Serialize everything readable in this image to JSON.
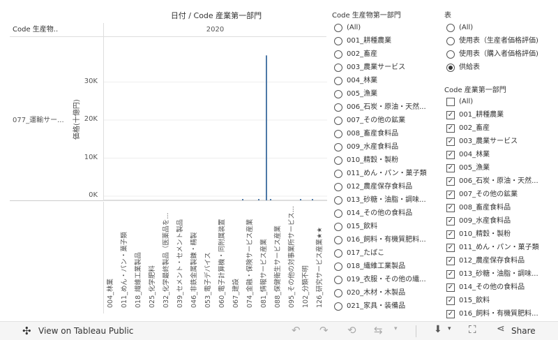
{
  "sheet": {
    "title": "日付 / Code 産業第一部門",
    "row_header": "Code 生産物..",
    "column_header": "2020",
    "row_label": "077_運輸サー...",
    "y_axis_title": "価格(十億円)"
  },
  "chart_data": {
    "type": "bar",
    "ylabel": "価格(十億円)",
    "ylim": [
      0,
      40000
    ],
    "y_ticks": [
      "0K",
      "10K",
      "20K",
      "30K"
    ],
    "categories": [
      "004_林業",
      "011_めん・パン・菓子類",
      "018_繊維工業製品",
      "025_化学肥料",
      "032_化学最終製品（医薬品を...",
      "039_セメント・セメント製品",
      "046_非鉄金属製錬・精製",
      "053_電子デバイス",
      "060_電子計算機・同附属装置",
      "067_建設",
      "074_金融・保険サービス産業",
      "081_情報サービス産業",
      "088_保健衛生サービス産業",
      "095_その他の対事業所サービス...",
      "102_分類不明",
      "126_研究サービス産業★★"
    ],
    "values": [
      0,
      0,
      0,
      0,
      0,
      0,
      0,
      0,
      0,
      0,
      0,
      37000,
      0,
      0,
      0,
      0
    ],
    "small_bars": [
      {
        "after_category": "067_建設",
        "value": 300
      },
      {
        "after_category": "074_金融・保険サービス産業",
        "value": 300
      },
      {
        "after_category": "081_情報サービス産業",
        "value": 200
      },
      {
        "after_category": "095_その他の対事業所サービス...",
        "value": 300
      },
      {
        "after_category": "102_分類不明",
        "value": 200
      }
    ],
    "bar_color": "#4e79a7"
  },
  "filter_product": {
    "title": "Code 生産物第一部門",
    "items": [
      "(All)",
      "001_耕種農業",
      "002_畜産",
      "003_農業サービス",
      "004_林業",
      "005_漁業",
      "006_石炭・原油・天然...",
      "007_その他の鉱業",
      "008_畜産食料品",
      "009_水産食料品",
      "010_精穀・製粉",
      "011_めん・パン・菓子類",
      "012_農産保存食料品",
      "013_砂糖・油脂・調味...",
      "014_その他の食料品",
      "015_飲料",
      "016_飼料・有機質肥料...",
      "017_たばこ",
      "018_繊維工業製品",
      "019_衣服・その他の繊...",
      "020_木材・木製品",
      "021_家具・装備品"
    ]
  },
  "filter_table": {
    "title": "表",
    "items": [
      "(All)",
      "使用表（生産者価格評価)",
      "使用表（購入者価格評価)",
      "供給表"
    ],
    "selected": "供給表"
  },
  "filter_industry": {
    "title": "Code 産業第一部門",
    "items": [
      {
        "label": "(All)",
        "checked": false
      },
      {
        "label": "001_耕種農業",
        "checked": true
      },
      {
        "label": "002_畜産",
        "checked": true
      },
      {
        "label": "003_農業サービス",
        "checked": true
      },
      {
        "label": "004_林業",
        "checked": true
      },
      {
        "label": "005_漁業",
        "checked": true
      },
      {
        "label": "006_石炭・原油・天然...",
        "checked": true
      },
      {
        "label": "007_その他の鉱業",
        "checked": true
      },
      {
        "label": "008_畜産食料品",
        "checked": true
      },
      {
        "label": "009_水産食料品",
        "checked": true
      },
      {
        "label": "010_精穀・製粉",
        "checked": true
      },
      {
        "label": "011_めん・パン・菓子類",
        "checked": true
      },
      {
        "label": "012_農産保存食料品",
        "checked": true
      },
      {
        "label": "013_砂糖・油脂・調味...",
        "checked": true
      },
      {
        "label": "014_その他の食料品",
        "checked": true
      },
      {
        "label": "015_飲料",
        "checked": true
      },
      {
        "label": "016_飼料・有機質肥料...",
        "checked": true
      }
    ]
  },
  "toolbar": {
    "view_label": "View on Tableau Public",
    "share_label": "Share"
  }
}
